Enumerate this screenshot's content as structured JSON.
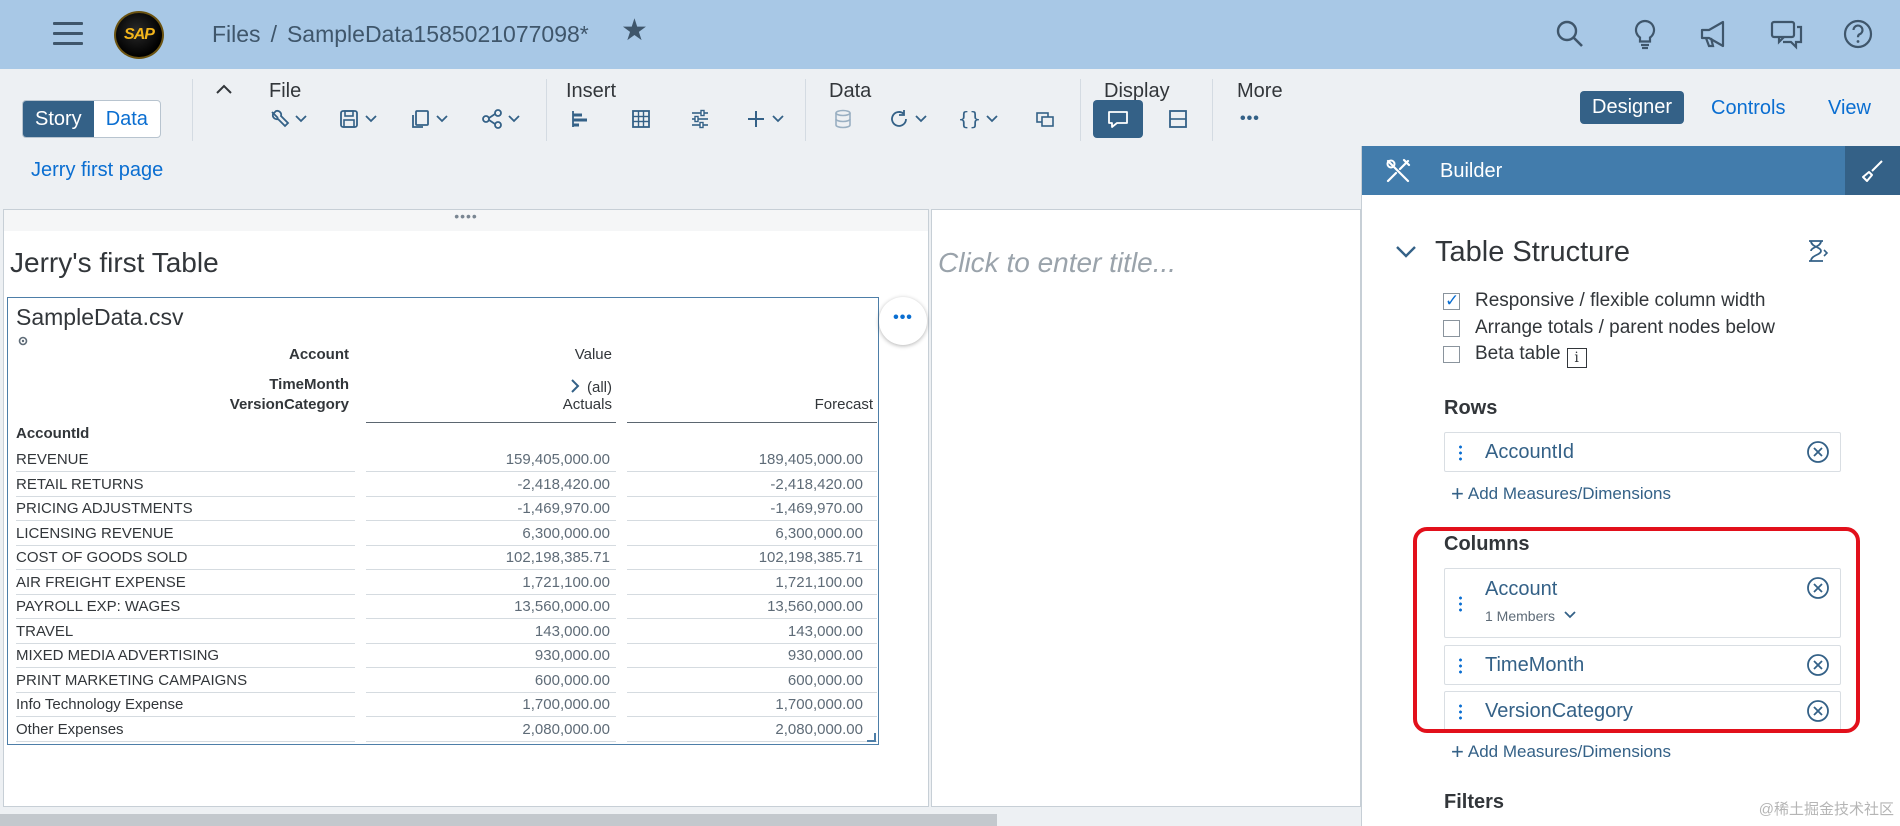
{
  "shell": {
    "breadcrumb_root": "Files",
    "separator": "/",
    "file_name": "SampleData1585021077098*",
    "logo_text": "SAP"
  },
  "toolbar": {
    "story_label": "Story",
    "data_label": "Data",
    "file_label": "File",
    "insert_label": "Insert",
    "data_group_label": "Data",
    "display_label": "Display",
    "more_label": "More",
    "tabs": [
      "Designer",
      "Controls",
      "View"
    ]
  },
  "page_tab": "Jerry first page",
  "table": {
    "title": "Jerry's first Table",
    "source": "SampleData.csv",
    "header_account": "Account",
    "header_value": "Value",
    "header_timemonth": "TimeMonth",
    "header_all": "(all)",
    "header_versioncategory": "VersionCategory",
    "col_actuals": "Actuals",
    "col_forecast": "Forecast",
    "row_dim": "AccountId",
    "rows": [
      {
        "label": "REVENUE",
        "actuals": "159,405,000.00",
        "forecast": "189,405,000.00"
      },
      {
        "label": "RETAIL RETURNS",
        "actuals": "-2,418,420.00",
        "forecast": "-2,418,420.00"
      },
      {
        "label": "PRICING ADJUSTMENTS",
        "actuals": "-1,469,970.00",
        "forecast": "-1,469,970.00"
      },
      {
        "label": "LICENSING REVENUE",
        "actuals": "6,300,000.00",
        "forecast": "6,300,000.00"
      },
      {
        "label": "COST OF GOODS SOLD",
        "actuals": "102,198,385.71",
        "forecast": "102,198,385.71"
      },
      {
        "label": "AIR FREIGHT EXPENSE",
        "actuals": "1,721,100.00",
        "forecast": "1,721,100.00"
      },
      {
        "label": "PAYROLL EXP: WAGES",
        "actuals": "13,560,000.00",
        "forecast": "13,560,000.00"
      },
      {
        "label": "TRAVEL",
        "actuals": "143,000.00",
        "forecast": "143,000.00"
      },
      {
        "label": "MIXED MEDIA ADVERTISING",
        "actuals": "930,000.00",
        "forecast": "930,000.00"
      },
      {
        "label": "PRINT MARKETING CAMPAIGNS",
        "actuals": "600,000.00",
        "forecast": "600,000.00"
      },
      {
        "label": "Info Technology Expense",
        "actuals": "1,700,000.00",
        "forecast": "1,700,000.00"
      },
      {
        "label": "Other Expenses",
        "actuals": "2,080,000.00",
        "forecast": "2,080,000.00"
      }
    ]
  },
  "panel2_placeholder": "Click to enter title...",
  "builder": {
    "title": "Builder",
    "section_title": "Table Structure",
    "options": [
      {
        "label": "Responsive / flexible column width",
        "checked": true
      },
      {
        "label": "Arrange totals / parent nodes below",
        "checked": false
      },
      {
        "label": "Beta table",
        "checked": false
      }
    ],
    "info_glyph": "i",
    "rows_heading": "Rows",
    "rows": [
      {
        "name": "AccountId"
      }
    ],
    "add_label": "Add Measures/Dimensions",
    "columns_heading": "Columns",
    "columns": [
      {
        "name": "Account",
        "sub": "1 Members"
      },
      {
        "name": "TimeMonth"
      },
      {
        "name": "VersionCategory"
      }
    ],
    "filters_heading": "Filters"
  },
  "watermark": "@稀土掘金技术社区",
  "colors": {
    "shell_bg": "#a8c8e6",
    "accent": "#346187",
    "link": "#0a6ed1",
    "builder_header": "#427cac",
    "highlight": "#e2101b"
  }
}
